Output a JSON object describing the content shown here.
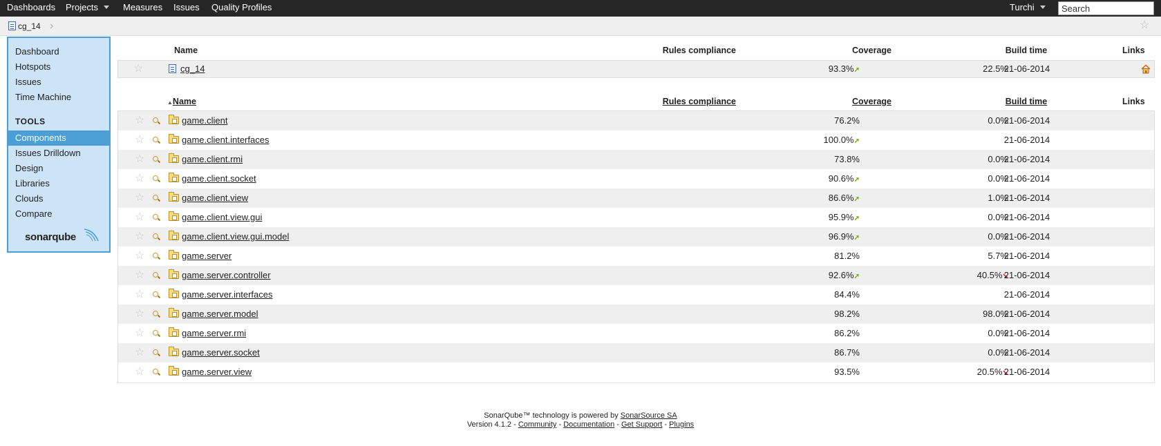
{
  "nav": {
    "dashboards": "Dashboards",
    "projects": "Projects",
    "measures": "Measures",
    "issues": "Issues",
    "quality_profiles": "Quality Profiles",
    "user": "Turchi",
    "search_placeholder": "Search"
  },
  "breadcrumb": {
    "project": "cg_14"
  },
  "sidebar": {
    "items": [
      "Dashboard",
      "Hotspots",
      "Issues",
      "Time Machine"
    ],
    "tools_heading": "TOOLS",
    "tools": [
      "Components",
      "Issues Drilldown",
      "Design",
      "Libraries",
      "Clouds",
      "Compare"
    ],
    "active": "Components",
    "logo": "sonarqube"
  },
  "columns": {
    "name": "Name",
    "rules_compliance": "Rules compliance",
    "coverage": "Coverage",
    "build_time": "Build time",
    "links": "Links"
  },
  "project": {
    "name": "cg_14",
    "rules_compliance": "93.3%",
    "rules_trend": "up",
    "coverage": "22.5%",
    "build_time": "21-06-2014",
    "link_icon": "home-icon"
  },
  "components": [
    {
      "name": "game.client",
      "rules": "76.2%",
      "rules_trend": "",
      "coverage": "0.0%",
      "coverage_trend": "",
      "build": "21-06-2014"
    },
    {
      "name": "game.client.interfaces",
      "rules": "100.0%",
      "rules_trend": "up",
      "coverage": "",
      "coverage_trend": "",
      "build": "21-06-2014"
    },
    {
      "name": "game.client.rmi",
      "rules": "73.8%",
      "rules_trend": "",
      "coverage": "0.0%",
      "coverage_trend": "",
      "build": "21-06-2014"
    },
    {
      "name": "game.client.socket",
      "rules": "90.6%",
      "rules_trend": "up",
      "coverage": "0.0%",
      "coverage_trend": "",
      "build": "21-06-2014"
    },
    {
      "name": "game.client.view",
      "rules": "86.6%",
      "rules_trend": "up",
      "coverage": "1.0%",
      "coverage_trend": "",
      "build": "21-06-2014"
    },
    {
      "name": "game.client.view.gui",
      "rules": "95.9%",
      "rules_trend": "up",
      "coverage": "0.0%",
      "coverage_trend": "",
      "build": "21-06-2014"
    },
    {
      "name": "game.client.view.gui.model",
      "rules": "96.9%",
      "rules_trend": "up",
      "coverage": "0.0%",
      "coverage_trend": "",
      "build": "21-06-2014"
    },
    {
      "name": "game.server",
      "rules": "81.2%",
      "rules_trend": "",
      "coverage": "5.7%",
      "coverage_trend": "",
      "build": "21-06-2014"
    },
    {
      "name": "game.server.controller",
      "rules": "92.6%",
      "rules_trend": "up",
      "coverage": "40.5%",
      "coverage_trend": "down",
      "build": "21-06-2014"
    },
    {
      "name": "game.server.interfaces",
      "rules": "84.4%",
      "rules_trend": "",
      "coverage": "",
      "coverage_trend": "",
      "build": "21-06-2014"
    },
    {
      "name": "game.server.model",
      "rules": "98.2%",
      "rules_trend": "",
      "coverage": "98.0%",
      "coverage_trend": "",
      "build": "21-06-2014"
    },
    {
      "name": "game.server.rmi",
      "rules": "86.2%",
      "rules_trend": "",
      "coverage": "0.0%",
      "coverage_trend": "",
      "build": "21-06-2014"
    },
    {
      "name": "game.server.socket",
      "rules": "86.7%",
      "rules_trend": "",
      "coverage": "0.0%",
      "coverage_trend": "",
      "build": "21-06-2014"
    },
    {
      "name": "game.server.view",
      "rules": "93.5%",
      "rules_trend": "",
      "coverage": "20.5%",
      "coverage_trend": "down",
      "build": "21-06-2014"
    }
  ],
  "footer": {
    "line1_prefix": "SonarQube™ technology is powered by",
    "line1_link": "SonarSource SA",
    "version": "Version 4.1.2 -",
    "community": "Community",
    "documentation": "Documentation",
    "support": "Get Support",
    "plugins": "Plugins"
  },
  "colors": {
    "nav_bg": "#262626",
    "sidebar_bg": "#cde4f6",
    "sidebar_active": "#4b9fd5",
    "trend_up": "#6cb400",
    "trend_down": "#e01a1a"
  }
}
